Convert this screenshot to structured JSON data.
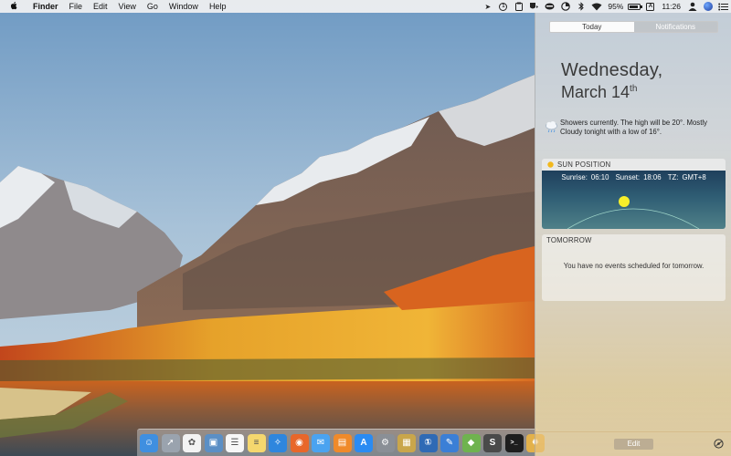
{
  "menubar": {
    "apple": "",
    "app_name": "Finder",
    "menus": [
      "File",
      "Edit",
      "View",
      "Go",
      "Window",
      "Help"
    ],
    "battery_percent": "95%",
    "battery_level": 0.95,
    "input_source": "A",
    "time": "11:26"
  },
  "notification_center": {
    "tabs": [
      {
        "label": "Today",
        "active": true
      },
      {
        "label": "Notifications",
        "active": false
      }
    ],
    "date": {
      "weekday": "Wednesday,",
      "month_day": "March 14",
      "suffix": "th"
    },
    "weather": {
      "icon": "rain-cloud-icon",
      "text": "Showers currently. The high will be 20°. Mostly Cloudy tonight with a low of 16°."
    },
    "sun_position": {
      "title": "SUN POSITION",
      "sunrise_label": "Sunrise:",
      "sunrise": "06:10",
      "sunset_label": "Sunset:",
      "sunset": "18:06",
      "tz_label": "TZ:",
      "tz": "GMT+8"
    },
    "tomorrow": {
      "title": "TOMORROW",
      "text": "You have no events scheduled for tomorrow."
    },
    "edit_label": "Edit"
  },
  "dock": {
    "apps": [
      {
        "name": "finder",
        "color": "#3f8fe0",
        "glyph": "☺"
      },
      {
        "name": "launchpad",
        "color": "#9aa3ae",
        "glyph": "➚"
      },
      {
        "name": "photos",
        "color": "#f3f3f3",
        "glyph": "✿"
      },
      {
        "name": "preview",
        "color": "#5b8fc5",
        "glyph": "▣"
      },
      {
        "name": "reminders",
        "color": "#f7f7f7",
        "glyph": "☰"
      },
      {
        "name": "notes",
        "color": "#f5d76e",
        "glyph": "≡"
      },
      {
        "name": "safari",
        "color": "#2e86de",
        "glyph": "✧"
      },
      {
        "name": "firefox",
        "color": "#e8672a",
        "glyph": "◉"
      },
      {
        "name": "messages",
        "color": "#4aa3f0",
        "glyph": "✉"
      },
      {
        "name": "books",
        "color": "#f08a2a",
        "glyph": "▤"
      },
      {
        "name": "app-store",
        "color": "#2a8bf2",
        "glyph": "A"
      },
      {
        "name": "system-preferences",
        "color": "#8a8f96",
        "glyph": "⚙"
      },
      {
        "name": "archive-utility",
        "color": "#c9a64b",
        "glyph": "▦"
      },
      {
        "name": "1password",
        "color": "#2f6ab5",
        "glyph": "①"
      },
      {
        "name": "xcode",
        "color": "#3b7fd6",
        "glyph": "✎"
      },
      {
        "name": "android-studio",
        "color": "#6fb34f",
        "glyph": "◆"
      },
      {
        "name": "sublime-text",
        "color": "#4a4a4a",
        "glyph": "S"
      },
      {
        "name": "terminal",
        "color": "#1e1e1e",
        "glyph": ">_"
      },
      {
        "name": "misc-app",
        "color": "#e3b14a",
        "glyph": "✹"
      }
    ]
  }
}
